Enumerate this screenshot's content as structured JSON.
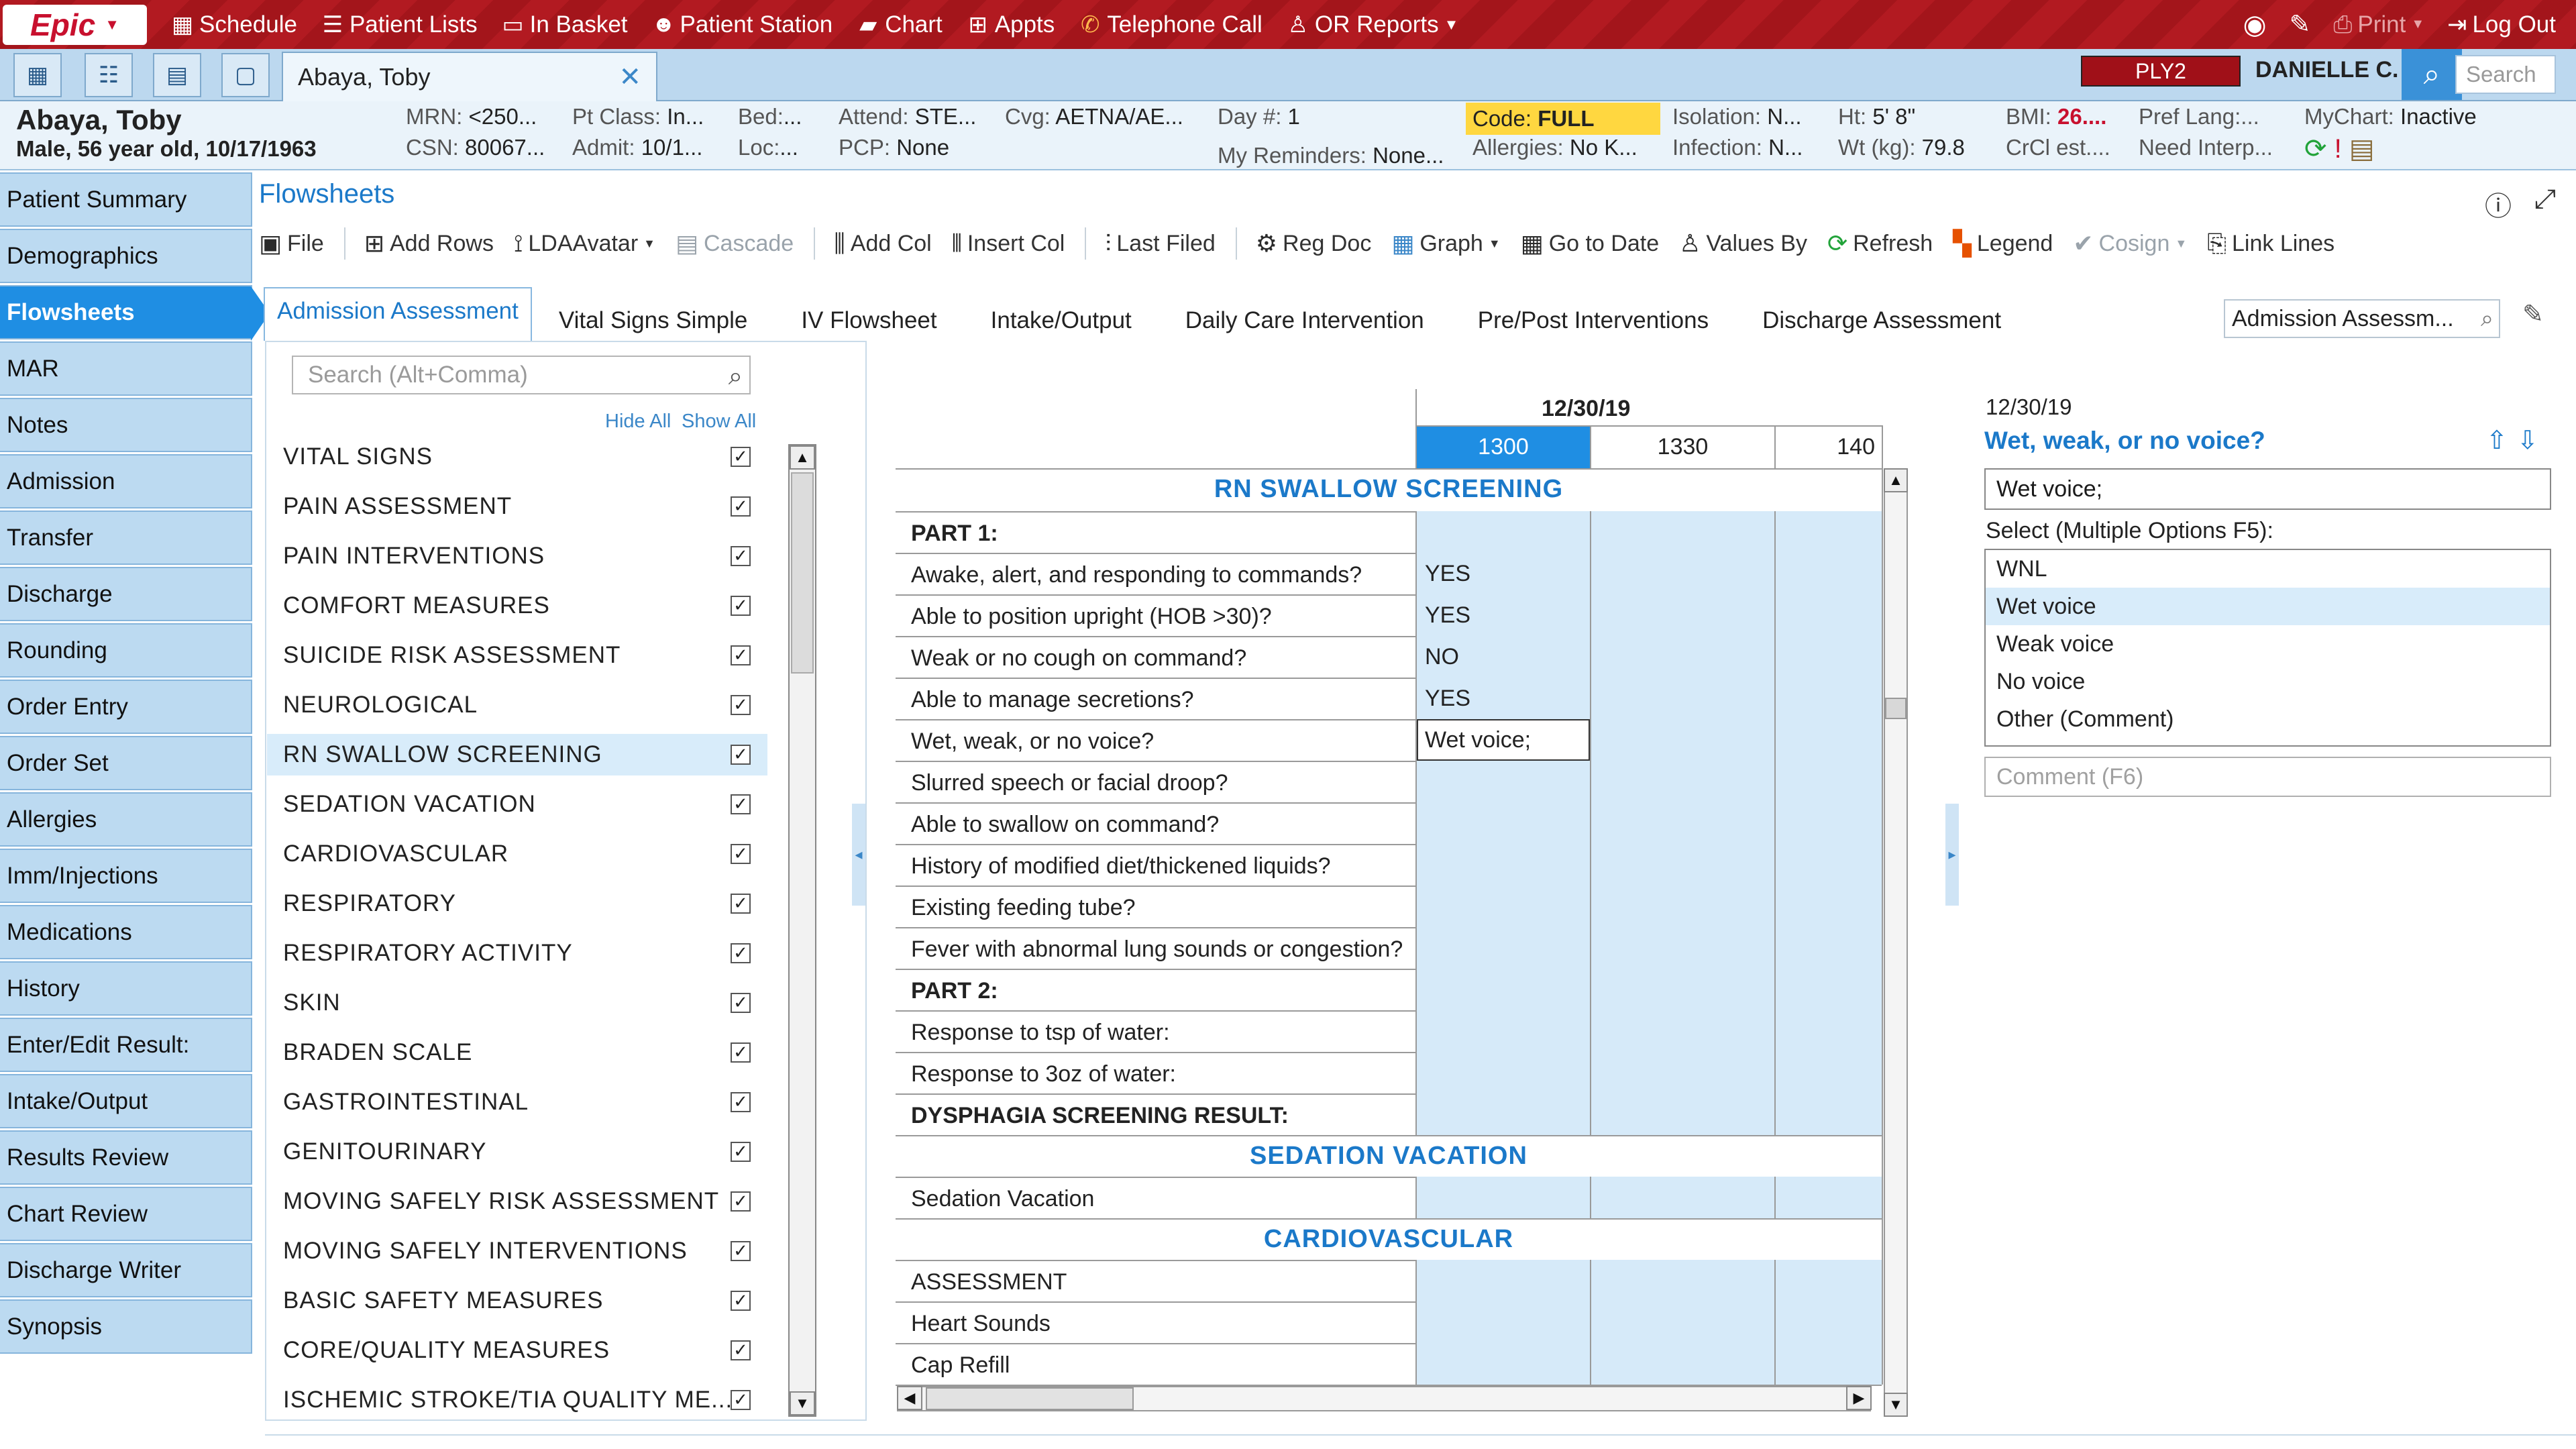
{
  "topbar": {
    "logo": "Epic",
    "items": [
      {
        "icon": "calendar-icon",
        "label": "Schedule"
      },
      {
        "icon": "list-icon",
        "label": "Patient Lists"
      },
      {
        "icon": "inbox-icon",
        "label": "In Basket"
      },
      {
        "icon": "people-icon",
        "label": "Patient Station"
      },
      {
        "icon": "folder-icon",
        "label": "Chart"
      },
      {
        "icon": "network-icon",
        "label": "Appts"
      },
      {
        "icon": "phone-icon",
        "label": "Telephone Call"
      },
      {
        "icon": "surgeon-icon",
        "label": "OR Reports"
      }
    ],
    "print_label": "Print",
    "logout_label": "Log Out"
  },
  "patient_tab": {
    "label": "Abaya, Toby"
  },
  "environment": "PLY2",
  "user": "DANIELLE C.",
  "search_placeholder": "Search",
  "header": {
    "name": "Abaya, Toby",
    "sub": "Male, 56 year old, 10/17/1963",
    "mrn_label": "MRN:",
    "mrn": "<250...",
    "csn_label": "CSN:",
    "csn": "80067...",
    "ptclass_label": "Pt Class:",
    "ptclass": "In...",
    "admit_label": "Admit:",
    "admit": "10/1...",
    "bed_label": "Bed:",
    "bed": "...",
    "loc_label": "Loc:",
    "loc": "...",
    "attend_label": "Attend:",
    "attend": "STE...",
    "pcp_label": "PCP:",
    "pcp": "None",
    "cvg_label": "Cvg:",
    "cvg": "AETNA/AE...",
    "day_label": "Day #:",
    "day": "1",
    "reminders_label": "My Reminders:",
    "reminders": "None...",
    "code_label": "Code:",
    "code": "FULL",
    "allergies_label": "Allergies:",
    "allergies": "No K...",
    "isolation_label": "Isolation:",
    "isolation": "N...",
    "infection_label": "Infection:",
    "infection": "N...",
    "ht_label": "Ht:",
    "ht": "5' 8\"",
    "wt_label": "Wt (kg):",
    "wt": "79.8",
    "bmi_label": "BMI:",
    "bmi": "26....",
    "crcl_label": "CrCl est....",
    "preflang_label": "Pref Lang:...",
    "interp_label": "Need Interp...",
    "mychart_label": "MyChart:",
    "mychart": "Inactive",
    "colors": {
      "code_bg": "#ffd740",
      "bmi": "#c8102e"
    }
  },
  "sidebar": [
    "Patient Summary",
    "Demographics",
    "Flowsheets",
    "MAR",
    "Notes",
    "Admission",
    "Transfer",
    "Discharge",
    "Rounding",
    "Order Entry",
    "Order Set",
    "Allergies",
    "Imm/Injections",
    "Medications",
    "History",
    "Enter/Edit Result:",
    "Intake/Output",
    "Results Review",
    "Chart Review",
    "Discharge Writer",
    "Synopsis"
  ],
  "sidebar_active": "Flowsheets",
  "flowsheets": {
    "title": "Flowsheets",
    "toolbar": [
      {
        "icon": "save-icon",
        "label": "File"
      },
      {
        "icon": "add-rows-icon",
        "label": "Add Rows"
      },
      {
        "icon": "lda-avatar-icon",
        "label": "LDAAvatar"
      },
      {
        "icon": "cascade-icon",
        "label": "Cascade"
      },
      {
        "icon": "add-col-icon",
        "label": "Add Col"
      },
      {
        "icon": "insert-col-icon",
        "label": "Insert Col"
      },
      {
        "icon": "last-filed-icon",
        "label": "Last Filed"
      },
      {
        "icon": "reg-doc-icon",
        "label": "Reg Doc"
      },
      {
        "icon": "graph-icon",
        "label": "Graph"
      },
      {
        "icon": "calendar-icon",
        "label": "Go to Date"
      },
      {
        "icon": "values-by-icon",
        "label": "Values By"
      },
      {
        "icon": "refresh-icon",
        "label": "Refresh"
      },
      {
        "icon": "legend-icon",
        "label": "Legend"
      },
      {
        "icon": "check-icon",
        "label": "Cosign"
      },
      {
        "icon": "link-icon",
        "label": "Link Lines"
      }
    ],
    "tabs": [
      "Admission Assessment",
      "Vital Signs Simple",
      "IV Flowsheet",
      "Intake/Output",
      "Daily Care Intervention",
      "Pre/Post Interventions",
      "Discharge Assessment"
    ],
    "tab_search": "Admission Assessm...",
    "section_search_placeholder": "Search (Alt+Comma)",
    "hide_all": "Hide All",
    "show_all": "Show All",
    "sections": [
      "VITAL SIGNS",
      "PAIN ASSESSMENT",
      "PAIN INTERVENTIONS",
      "COMFORT MEASURES",
      "SUICIDE RISK ASSESSMENT",
      "NEUROLOGICAL",
      "RN SWALLOW SCREENING",
      "SEDATION VACATION",
      "CARDIOVASCULAR",
      "RESPIRATORY",
      "RESPIRATORY ACTIVITY",
      "SKIN",
      "BRADEN SCALE",
      "GASTROINTESTINAL",
      "GENITOURINARY",
      "MOVING SAFELY RISK ASSESSMENT",
      "MOVING SAFELY INTERVENTIONS",
      "BASIC SAFETY MEASURES",
      "CORE/QUALITY MEASURES",
      "ISCHEMIC STROKE/TIA QUALITY ME..."
    ],
    "selected_section": "RN SWALLOW SCREENING",
    "grid": {
      "date": "12/30/19",
      "times": [
        "1300",
        "1330",
        "140"
      ],
      "sec_swallow": "RN SWALLOW SCREENING",
      "sec_sedation": "SEDATION VACATION",
      "sec_cardio": "CARDIOVASCULAR",
      "rows": [
        {
          "label": "PART 1:",
          "value": ""
        },
        {
          "label": "Awake, alert, and responding to commands?",
          "value": "YES"
        },
        {
          "label": "Able to position upright (HOB >30)?",
          "value": "YES"
        },
        {
          "label": "Weak or no cough on command?",
          "value": "NO"
        },
        {
          "label": "Able to manage secretions?",
          "value": "YES"
        },
        {
          "label": "Wet, weak, or no voice?",
          "value": "Wet voice;"
        },
        {
          "label": "Slurred speech or facial droop?",
          "value": ""
        },
        {
          "label": "Able to swallow on command?",
          "value": ""
        },
        {
          "label": "History of modified diet/thickened liquids?",
          "value": ""
        },
        {
          "label": "Existing feeding tube?",
          "value": ""
        },
        {
          "label": "Fever with abnormal lung sounds or congestion?",
          "value": ""
        },
        {
          "label": "PART 2:",
          "value": ""
        },
        {
          "label": "Response to tsp of water:",
          "value": ""
        },
        {
          "label": "Response to 3oz of water:",
          "value": ""
        },
        {
          "label": "DYSPHAGIA SCREENING RESULT:",
          "value": ""
        }
      ],
      "sedation_row": "Sedation Vacation",
      "cardio_rows": [
        "ASSESSMENT",
        "Heart Sounds",
        "Cap Refill"
      ]
    }
  },
  "right_panel": {
    "date": "12/30/19",
    "question": "Wet,  weak, or no voice?",
    "value": "Wet voice;",
    "select_label": "Select (Multiple Options F5):",
    "options": [
      "WNL",
      "Wet voice",
      "Weak voice",
      "No voice",
      "Other (Comment)"
    ],
    "selected_option": "Wet voice",
    "comment_placeholder": "Comment (F6)"
  }
}
